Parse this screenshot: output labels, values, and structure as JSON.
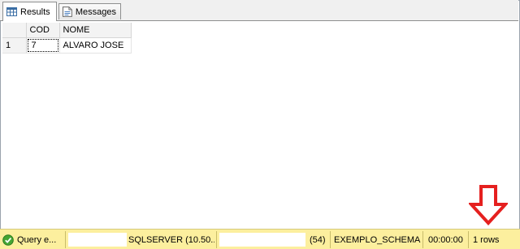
{
  "tabs": [
    {
      "label": "Results",
      "icon": "grid-icon",
      "active": true
    },
    {
      "label": "Messages",
      "icon": "messages-icon",
      "active": false
    }
  ],
  "results_grid": {
    "columns": [
      "COD",
      "NOME"
    ],
    "rows": [
      {
        "row_number": "1",
        "cells": [
          "7",
          "ALVARO JOSE"
        ]
      }
    ]
  },
  "annotation": {
    "arrow_color": "#e5201f",
    "arrow_direction": "down"
  },
  "status_bar": {
    "query_status": "Query e...",
    "server": "SQLSERVER (10.50...",
    "spid": "(54)",
    "database": "EXEMPLO_SCHEMA",
    "elapsed": "00:00:00",
    "row_count": "1 rows",
    "background_color": "#fcef9e"
  }
}
